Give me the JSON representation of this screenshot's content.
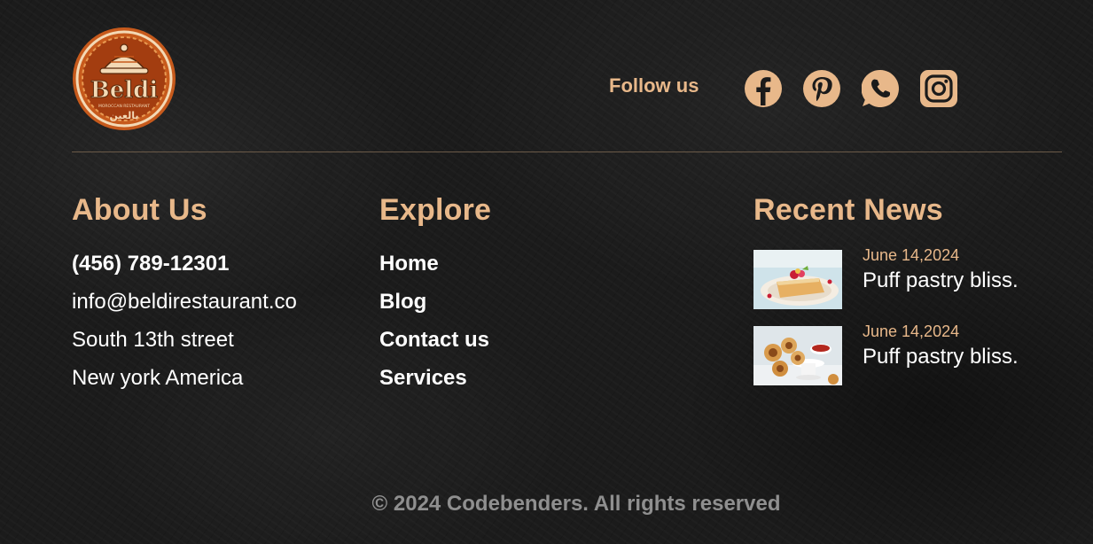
{
  "brand": {
    "logo_text": "Beldi",
    "logo_subtitle": "MOROCCAN RESTAURANT",
    "logo_arabic": "بالعين"
  },
  "social": {
    "label": "Follow us",
    "icons": [
      "facebook-icon",
      "pinterest-icon",
      "whatsapp-icon",
      "instagram-icon"
    ]
  },
  "about": {
    "title": "About Us",
    "phone": "(456) 789-12301",
    "email": "info@beldirestaurant.co",
    "street": "South 13th street",
    "city": "New york America"
  },
  "explore": {
    "title": "Explore",
    "links": [
      "Home",
      "Blog",
      "Contact us",
      "Services"
    ]
  },
  "news": {
    "title": "Recent News",
    "items": [
      {
        "date": "June 14,2024",
        "title": "Puff pastry bliss."
      },
      {
        "date": "June 14,2024",
        "title": "Puff pastry bliss."
      }
    ]
  },
  "footer": {
    "copyright": "© 2024 Codebenders. All rights reserved"
  },
  "colors": {
    "accent": "#e8b88a",
    "text": "#ffffff",
    "muted": "#8f8f8f",
    "background": "#1b1b1b"
  }
}
